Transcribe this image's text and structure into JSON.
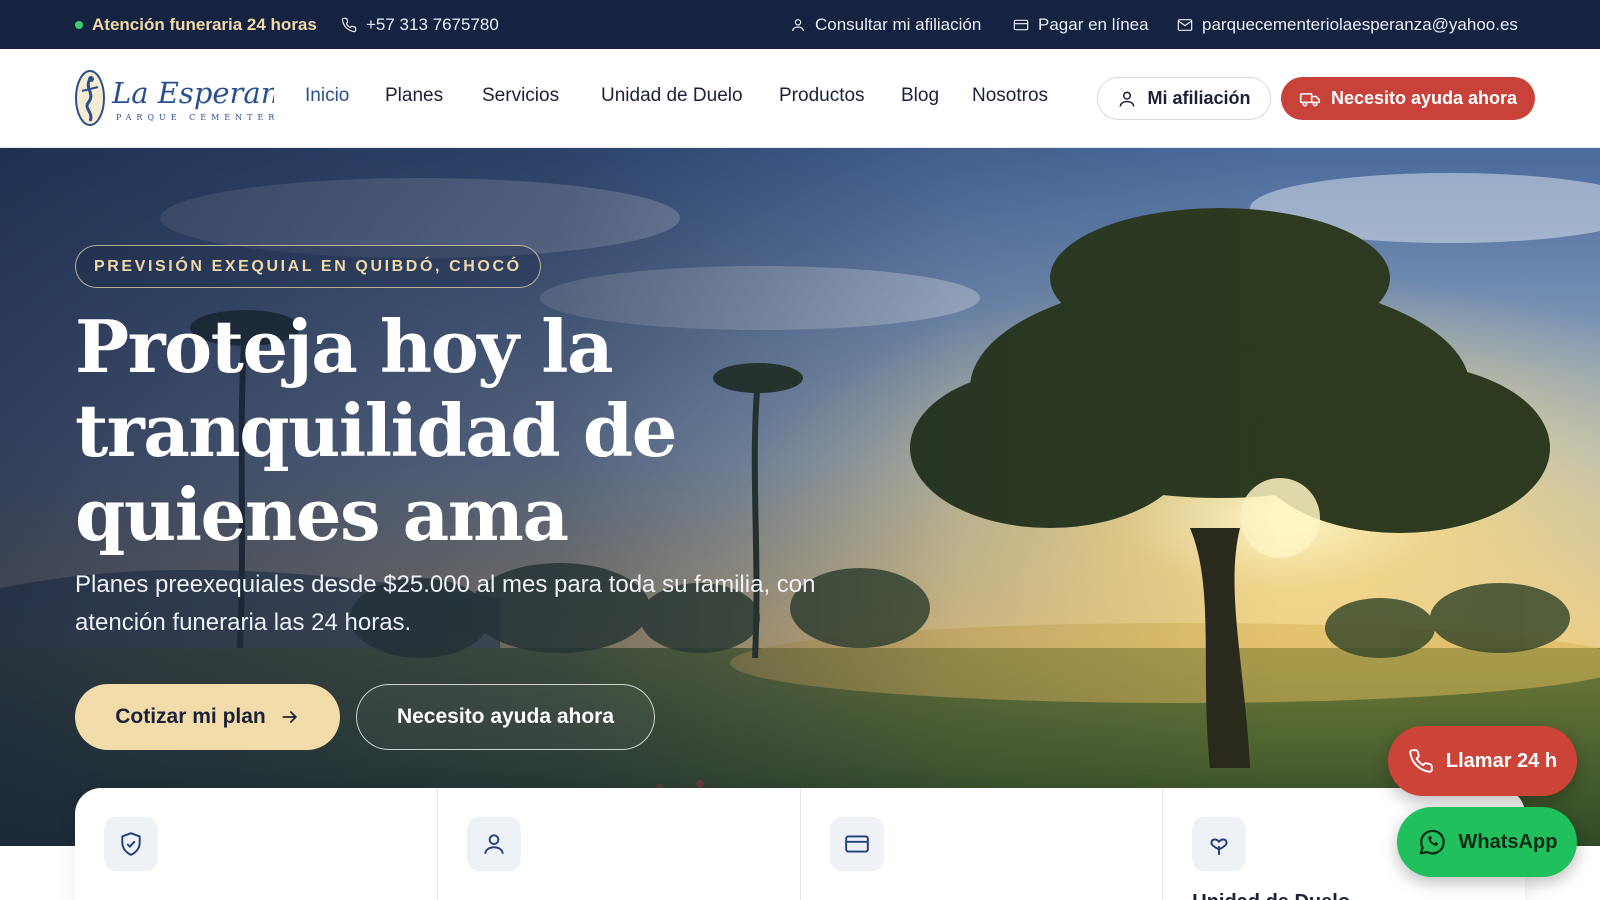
{
  "topbar": {
    "attention": "Atención funeraria 24 horas",
    "phone": "+57 313 7675780",
    "affiliation_link": "Consultar mi afiliación",
    "pay_link": "Pagar en línea",
    "email": "parquecementeriolaesperanza@yahoo.es"
  },
  "brand": {
    "name": "La Esperanza",
    "tagline": "PARQUE CEMENTERIO"
  },
  "nav": {
    "items": [
      {
        "label": "Inicio",
        "active": true
      },
      {
        "label": "Planes"
      },
      {
        "label": "Servicios"
      },
      {
        "label": "Unidad de Duelo"
      },
      {
        "label": "Productos"
      },
      {
        "label": "Blog"
      },
      {
        "label": "Nosotros"
      }
    ],
    "account_button": "Mi afiliación",
    "help_button": "Necesito ayuda ahora"
  },
  "hero": {
    "kicker": "PREVISIÓN EXEQUIAL EN QUIBDÓ, CHOCÓ",
    "title": "Proteja hoy la tranquilidad de quienes ama",
    "subtitle": "Planes preexequiales desde $25.000 al mes para toda su familia, con atención funeraria las 24 horas.",
    "primary_cta": "Cotizar mi plan",
    "secondary_cta": "Necesito ayuda ahora"
  },
  "cards": [
    {
      "icon": "shield-check-icon",
      "title": ""
    },
    {
      "icon": "user-icon",
      "title": ""
    },
    {
      "icon": "credit-card-icon",
      "title": ""
    },
    {
      "icon": "heart-hands-icon",
      "title": "Unidad de Duelo"
    }
  ],
  "floating": {
    "call": "Llamar 24 h",
    "whatsapp": "WhatsApp"
  },
  "colors": {
    "navy": "#152341",
    "accent_red": "#c8423a",
    "gold": "#f2dcaa",
    "whatsapp_green": "#20c05c"
  }
}
